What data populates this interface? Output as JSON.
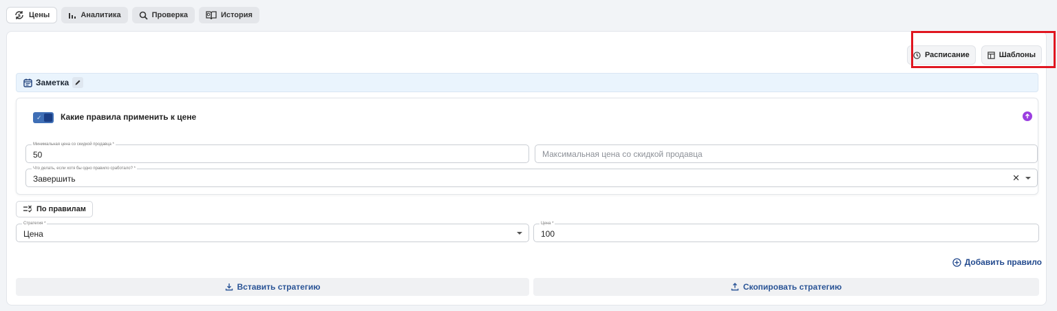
{
  "tabs": [
    {
      "label": "Цены",
      "icon": "price-sync-icon",
      "active": true
    },
    {
      "label": "Аналитика",
      "icon": "bar-chart-icon",
      "active": false
    },
    {
      "label": "Проверка",
      "icon": "search-icon",
      "active": false
    },
    {
      "label": "История",
      "icon": "history-book-icon",
      "active": false
    }
  ],
  "header_actions": {
    "schedule_label": "Расписание",
    "templates_label": "Шаблоны"
  },
  "note": {
    "label": "Заметка"
  },
  "rules_section": {
    "title": "Какие правила применить к цене",
    "enabled": true,
    "min_price": {
      "label": "Минимальная цена со скидкой продавца *",
      "value": "50"
    },
    "max_price": {
      "placeholder": "Максимальная цена со скидкой продавца"
    },
    "on_trigger": {
      "label": "Что делать, если хотя бы одно правило сработало? *",
      "value": "Завершить"
    }
  },
  "by_rules_label": "По правилам",
  "strategy": {
    "label": "Стратегия *",
    "value": "Цена"
  },
  "price": {
    "label": "Цена *",
    "value": "100"
  },
  "add_rule_label": "Добавить правило",
  "paste_strategy_label": "Вставить стратегию",
  "copy_strategy_label": "Скопировать стратегию",
  "colors": {
    "accent": "#234a8e",
    "highlight_box": "#e0151f",
    "note_bg": "#eaf4fd",
    "collapse_icon": "#9b3fe0"
  }
}
